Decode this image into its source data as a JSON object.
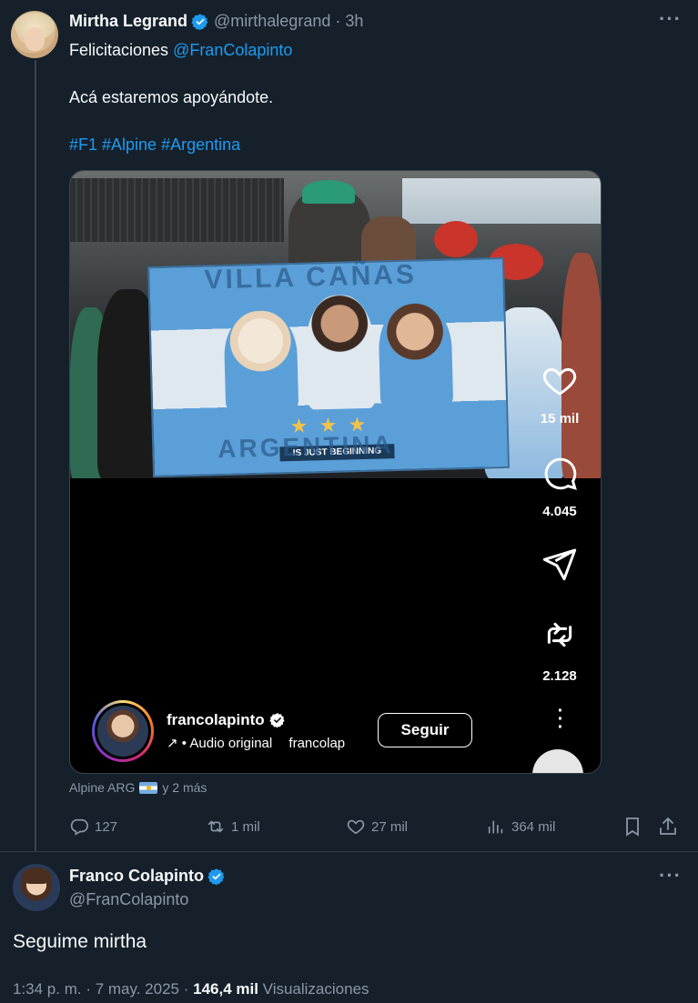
{
  "tweet": {
    "author_name": "Mirtha Legrand",
    "author_handle": "@mirthalegrand",
    "time": "· 3h",
    "line1_prefix": "Felicitaciones ",
    "line1_mention": "@FranColapinto",
    "line2": "Acá estaremos apoyándote.",
    "hashtags": "#F1 #Alpine #Argentina",
    "more_icon": "ellipsis-icon",
    "tagged_prefix": "Alpine ARG",
    "tagged_suffix": "y 2 más",
    "actions": {
      "replies": "127",
      "reposts": "1 mil",
      "likes": "27 mil",
      "views": "364 mil"
    }
  },
  "embed": {
    "flag_text_top": "VILLA CAÑAS",
    "flag_text_bottom": "ARGENTINA",
    "banner_text": "IS JUST BEGINNING",
    "likes_count": "15 mil",
    "comments_count": "4.045",
    "reposts_count": "2.128",
    "username": "francolapinto",
    "audio_arrow": "↗",
    "audio_label": "• Audio original",
    "audio_extra": "francolap",
    "follow_label": "Seguir"
  },
  "reply": {
    "author_name": "Franco Colapinto",
    "author_handle": "@FranColapinto",
    "text": "Seguime mirtha",
    "timestamp": "1:34 p. m. · 7 may. 2025 · ",
    "views_count": "146,4 mil",
    "views_label": " Visualizaciones"
  },
  "colors": {
    "background": "#15202b",
    "accent": "#1d9bf0",
    "muted": "#8b98a5",
    "verified": "#1d9bf0"
  }
}
